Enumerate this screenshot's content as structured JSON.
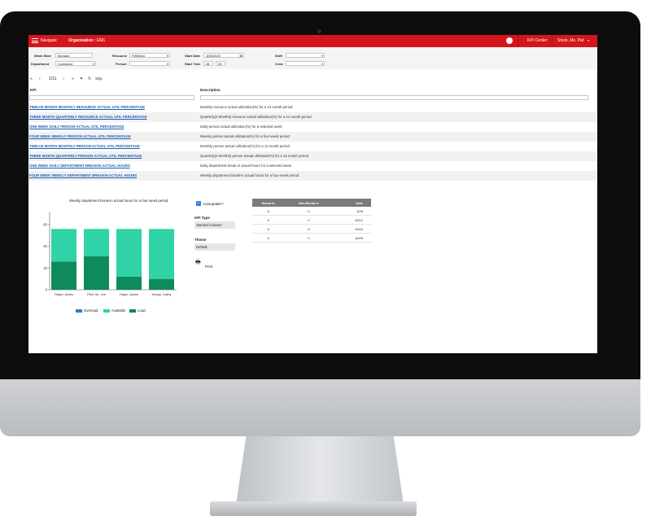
{
  "header": {
    "navigate_label": "Navigate",
    "organization_label": "Organization :",
    "organization_value": "EM1",
    "kpi_center_label": "KPI Center",
    "user_name": "Stock, Ms. Pat",
    "accent_color": "#d4161c"
  },
  "filters": {
    "week_start": {
      "label": "Week Start",
      "value": "Monday"
    },
    "department": {
      "label": "Department",
      "value": "Contractor"
    },
    "resource": {
      "label": "Resource",
      "value": "FWMech"
    },
    "person": {
      "label": "Person",
      "value": ""
    },
    "start_date": {
      "label": "Start Date",
      "value": "10/5/2020"
    },
    "start_time": {
      "label": "Start Time",
      "hour": "08",
      "minute": "00"
    },
    "shift": {
      "label": "Shift",
      "value": ""
    },
    "crew": {
      "label": "Crew",
      "value": ""
    }
  },
  "pager": {
    "first": "«",
    "prev": "‹",
    "page": "1/11",
    "next": "›",
    "last": "»",
    "sql": "SQL"
  },
  "table": {
    "col_kpi": "KPI",
    "col_description": "Description",
    "rows": [
      {
        "kpi": "TWELVE MONTH MONTHLY RESOURCE ACTUAL UTIL PERCENTAGE",
        "description": "Monthly resource actual utilization(%) for a 12 month period"
      },
      {
        "kpi": "THREE MONTH QUARTERLY RESOURCE ACTUAL UTIL PERCENTAGE",
        "description": "Quarterly(3 Months) resource actual utilization(%) for a 12 month period"
      },
      {
        "kpi": "ONE WEEK DAILY PERSON ACTUAL UTIL PERCENTAGE",
        "description": "Daily person actual utilization(%) for a selected week"
      },
      {
        "kpi": "FOUR WEEK WEEKLY PERSON ACTUAL UTIL PERCENTAGE",
        "description": "Weekly person actual utilization(%) for a four-week period"
      },
      {
        "kpi": "TWELVE MONTH MONTHLY PERSON ACTUAL UTIL PERCENTAGE",
        "description": "Monthly person actual utilization(%) for a 12 month period"
      },
      {
        "kpi": "THREE MONTH QUARTERLY PERSON ACTUAL UTIL PERCENTAGE",
        "description": "Quarterly(3 Months) person actual utilization(%) for a 12 month period"
      },
      {
        "kpi": "ONE WEEK DAILY DEPARTMENT BREAKIN ACTUAL HOURS",
        "description": "Daily department break-in actual hours for a selected week"
      },
      {
        "kpi": "FOUR WEEK WEEKLY DEPARTMENT BREAKIN ACTUAL HOURS",
        "description": "Weekly department break-in actual hours for a four-week period"
      }
    ]
  },
  "options": {
    "autoupdate_label": "Autoupdate?",
    "kpi_type_label": "KPI Type",
    "kpi_type_value": "Stacked Column",
    "theme_label": "Theme",
    "theme_value": "Default",
    "print_label": "Print"
  },
  "breakin_table": {
    "headers": [
      "Break In",
      "Non-Break In",
      "Date"
    ],
    "rows": [
      [
        "0",
        "0",
        "10/5"
      ],
      [
        "0",
        "0",
        "10/12"
      ],
      [
        "0",
        "0",
        "10/19"
      ],
      [
        "0",
        "0",
        "10/26"
      ]
    ]
  },
  "chart_data": {
    "type": "bar",
    "stacked": true,
    "title": "Weekly department break-in actual hours for a four-week period",
    "categories": [
      "Heger, Adam",
      "Pistl, Mr. Joe",
      "Heger, Adam",
      "Araujo, Kathy"
    ],
    "series": [
      {
        "name": "Overload",
        "color": "#2f80c9",
        "values": [
          0,
          0,
          0,
          0
        ]
      },
      {
        "name": "Load",
        "color": "#0f8a5a",
        "values": [
          26,
          31,
          12,
          10
        ]
      },
      {
        "name": "Available",
        "color": "#2fd3a6",
        "values": [
          30,
          25,
          44,
          46
        ]
      }
    ],
    "legend_order": [
      "Overload",
      "Available",
      "Load"
    ],
    "yticks": [
      0,
      20,
      40,
      60
    ],
    "ylim": [
      0,
      72
    ],
    "legend_position": "bottom",
    "grid": false
  }
}
